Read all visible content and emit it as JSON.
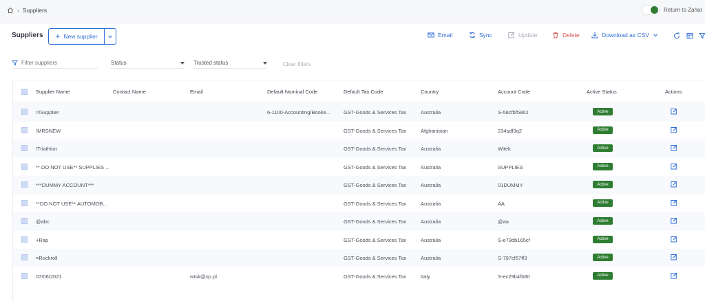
{
  "breadcrumb": {
    "current": "Suppliers"
  },
  "toggle": {
    "label": "Return to Zahar"
  },
  "header": {
    "title": "Suppliers",
    "new_label": "New supplier",
    "actions": {
      "email": "Email",
      "sync": "Sync",
      "update": "Update",
      "delete": "Delete",
      "download": "Download as CSV"
    }
  },
  "filters": {
    "search_placeholder": "Filter suppliers",
    "status": "Status",
    "trusted": "Trusted status",
    "clear": "Clear filters"
  },
  "table": {
    "columns": [
      "Supplier Name",
      "Contact Name",
      "Email",
      "Default Nominal Code",
      "Default Tax Code",
      "Country",
      "Account Code",
      "Active Status",
      "Actions"
    ],
    "rows": [
      {
        "name": "!!!Supplier",
        "contact": "",
        "email": "",
        "nominal": "6-1100-Accounting/Booke...",
        "tax": "GST-Goods & Services Tax",
        "country": "Australia",
        "account": "S-58cfbf5862",
        "status": "Active"
      },
      {
        "name": "!MRSNEW",
        "contact": "",
        "email": "",
        "nominal": "",
        "tax": "GST-Goods & Services Tax",
        "country": "Afghanistan",
        "account": "234sdf3q2",
        "status": "Active"
      },
      {
        "name": "!Triathlon",
        "contact": "",
        "email": "",
        "nominal": "",
        "tax": "GST-Goods & Services Tax",
        "country": "Australia",
        "account": "Witek",
        "status": "Active"
      },
      {
        "name": "** DO NOT USE** SUPPLIES ...",
        "contact": "",
        "email": "",
        "nominal": "",
        "tax": "GST-Goods & Services Tax",
        "country": "Australia",
        "account": "SUPPLIES",
        "status": "Active"
      },
      {
        "name": "***DUMMY ACCOUNT***",
        "contact": "",
        "email": "",
        "nominal": "",
        "tax": "GST-Goods & Services Tax",
        "country": "Australia",
        "account": "01DUMMY",
        "status": "Active"
      },
      {
        "name": "**DO NOT USE** AUTOMOB...",
        "contact": "",
        "email": "",
        "nominal": "",
        "tax": "GST-Goods & Services Tax",
        "country": "Australia",
        "account": "AA",
        "status": "Active"
      },
      {
        "name": "@abc",
        "contact": "",
        "email": "",
        "nominal": "",
        "tax": "GST-Goods & Services Tax",
        "country": "Australia",
        "account": "@aa",
        "status": "Active"
      },
      {
        "name": "+Rap",
        "contact": "",
        "email": "",
        "nominal": "",
        "tax": "GST-Goods & Services Tax",
        "country": "Australia",
        "account": "S-e79db165cf",
        "status": "Active"
      },
      {
        "name": "=Rockroll",
        "contact": "",
        "email": "",
        "nominal": "",
        "tax": "GST-Goods & Services Tax",
        "country": "Australia",
        "account": "S-797cf57ff3",
        "status": "Active"
      },
      {
        "name": "07/06/2021",
        "contact": "",
        "email": "wtsk@op.pl",
        "nominal": "",
        "tax": "GST-Goods & Services Tax",
        "country": "Italy",
        "account": "S-ec29b4fb80",
        "status": "Active"
      }
    ]
  },
  "colors": {
    "primary": "#2f6fd6",
    "active": "#2e7d32",
    "danger": "#d9534f"
  },
  "icons": [
    "home-icon",
    "chevron-right-icon",
    "plus-icon",
    "chevron-down-icon",
    "email-icon",
    "sync-icon",
    "edit-icon",
    "trash-icon",
    "download-icon",
    "refresh-icon",
    "columns-icon",
    "filter-icon"
  ]
}
